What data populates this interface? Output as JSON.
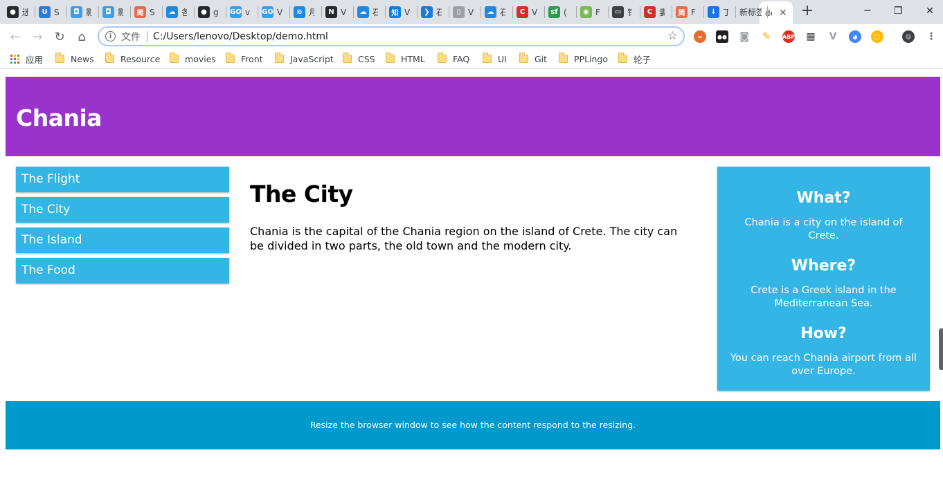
{
  "browser": {
    "tabs": [
      {
        "icon": "github-icon",
        "color": "#24292e",
        "glyph": "●",
        "title": "迷"
      },
      {
        "icon": "u-icon",
        "color": "#2b7bd8",
        "glyph": "U",
        "title": "S"
      },
      {
        "icon": "app-icon",
        "color": "#3aa0e6",
        "glyph": "◘",
        "title": "影"
      },
      {
        "icon": "app-icon",
        "color": "#3aa0e6",
        "glyph": "◘",
        "title": "影"
      },
      {
        "icon": "jianshu-icon",
        "color": "#e96a50",
        "glyph": "简",
        "title": "S"
      },
      {
        "icon": "cloud-icon",
        "color": "#1e88e5",
        "glyph": "☁",
        "title": "各"
      },
      {
        "icon": "github-icon",
        "color": "#24292e",
        "glyph": "●",
        "title": "g"
      },
      {
        "icon": "go-icon",
        "color": "#3aa0e6",
        "glyph": "GO",
        "title": "v"
      },
      {
        "icon": "go-icon",
        "color": "#3aa0e6",
        "glyph": "GO",
        "title": "V"
      },
      {
        "icon": "layers-icon",
        "color": "#1e88e5",
        "glyph": "≋",
        "title": "月"
      },
      {
        "icon": "node-icon",
        "color": "#24292e",
        "glyph": "N",
        "title": "V"
      },
      {
        "icon": "cloud-icon",
        "color": "#1e88e5",
        "glyph": "☁",
        "title": "石"
      },
      {
        "icon": "zhihu-icon",
        "color": "#0e80e6",
        "glyph": "知",
        "title": "V"
      },
      {
        "icon": "vscode-icon",
        "color": "#1f79d6",
        "glyph": "❯",
        "title": "石"
      },
      {
        "icon": "page-icon",
        "color": "#9aa0a6",
        "glyph": "▯",
        "title": "V"
      },
      {
        "icon": "cloud-icon",
        "color": "#1e88e5",
        "glyph": "☁",
        "title": "石"
      },
      {
        "icon": "csdn-icon",
        "color": "#d32f2f",
        "glyph": "C",
        "title": "V"
      },
      {
        "icon": "sf-icon",
        "color": "#2e9a4c",
        "glyph": "sf",
        "title": "("
      },
      {
        "icon": "game-icon",
        "color": "#79b956",
        "glyph": "◉",
        "title": "F"
      },
      {
        "icon": "book-icon",
        "color": "#3c4043",
        "glyph": "▭",
        "title": "钅"
      },
      {
        "icon": "csdn-icon",
        "color": "#d32f2f",
        "glyph": "C",
        "title": "妻"
      },
      {
        "icon": "jianshu-icon",
        "color": "#e96a50",
        "glyph": "简",
        "title": "F"
      },
      {
        "icon": "download-icon",
        "color": "#1a73e8",
        "glyph": "↓",
        "title": "丁"
      },
      {
        "icon": "",
        "color": "",
        "glyph": "",
        "title": "新标签"
      }
    ],
    "active_tab": {
      "title": "de"
    },
    "new_tab_label": "+",
    "window": {
      "minimize": "─",
      "restore": "❐",
      "close": "✕"
    },
    "nav": {
      "back": "←",
      "forward": "→",
      "reload": "↻",
      "home": "⌂"
    },
    "address": {
      "scheme_label": "文件",
      "url": "C:/Users/lenovo/Desktop/demo.html"
    },
    "extensions": [
      {
        "icon": "infinity-icon",
        "color": "#e8692c",
        "glyph": "∞"
      },
      {
        "icon": "tampermonkey-icon",
        "color": "#202124",
        "glyph": "●●"
      },
      {
        "icon": "camera-icon",
        "color": "#9aa0a6",
        "glyph": "◙"
      },
      {
        "icon": "eyedropper-icon",
        "color": "#f9ab00",
        "glyph": "✎"
      },
      {
        "icon": "adblock-icon",
        "color": "#d93025",
        "glyph": "ABP"
      },
      {
        "icon": "qr-icon",
        "color": "#3c4043",
        "glyph": "▦"
      },
      {
        "icon": "vue-icon",
        "color": "#9aa0a6",
        "glyph": "V"
      },
      {
        "icon": "owl-icon",
        "color": "#4285f4",
        "glyph": "◕"
      },
      {
        "icon": "chrome-ring-icon",
        "color": "#fbbc05",
        "glyph": "◯"
      },
      {
        "icon": "profile-icon",
        "color": "#3c4043",
        "glyph": "☺"
      },
      {
        "icon": "more-icon",
        "color": "#5f6368",
        "glyph": "⋮"
      }
    ],
    "bookmarks_apps_label": "应用",
    "bookmarks": [
      "News",
      "Resource",
      "movies",
      "Front",
      "JavaScript",
      "CSS",
      "HTML",
      "FAQ",
      "UI",
      "Git",
      "PPLingo",
      "轮子"
    ]
  },
  "site": {
    "header_title": "Chania",
    "menu": [
      "The Flight",
      "The City",
      "The Island",
      "The Food"
    ],
    "main": {
      "heading": "The City",
      "body": "Chania is the capital of the Chania region on the island of Crete. The city can be divided in two parts, the old town and the modern city."
    },
    "aside": [
      {
        "q": "What?",
        "a": "Chania is a city on the island of Crete."
      },
      {
        "q": "Where?",
        "a": "Crete is a Greek island in the Mediterranean Sea."
      },
      {
        "q": "How?",
        "a": "You can reach Chania airport from all over Europe."
      }
    ],
    "footer": "Resize the browser window to see how the content respond to the resizing."
  },
  "colors": {
    "header_bg": "#9933cc",
    "menu_bg": "#33b5e5",
    "aside_bg": "#33b5e5",
    "footer_bg": "#0099cc"
  }
}
